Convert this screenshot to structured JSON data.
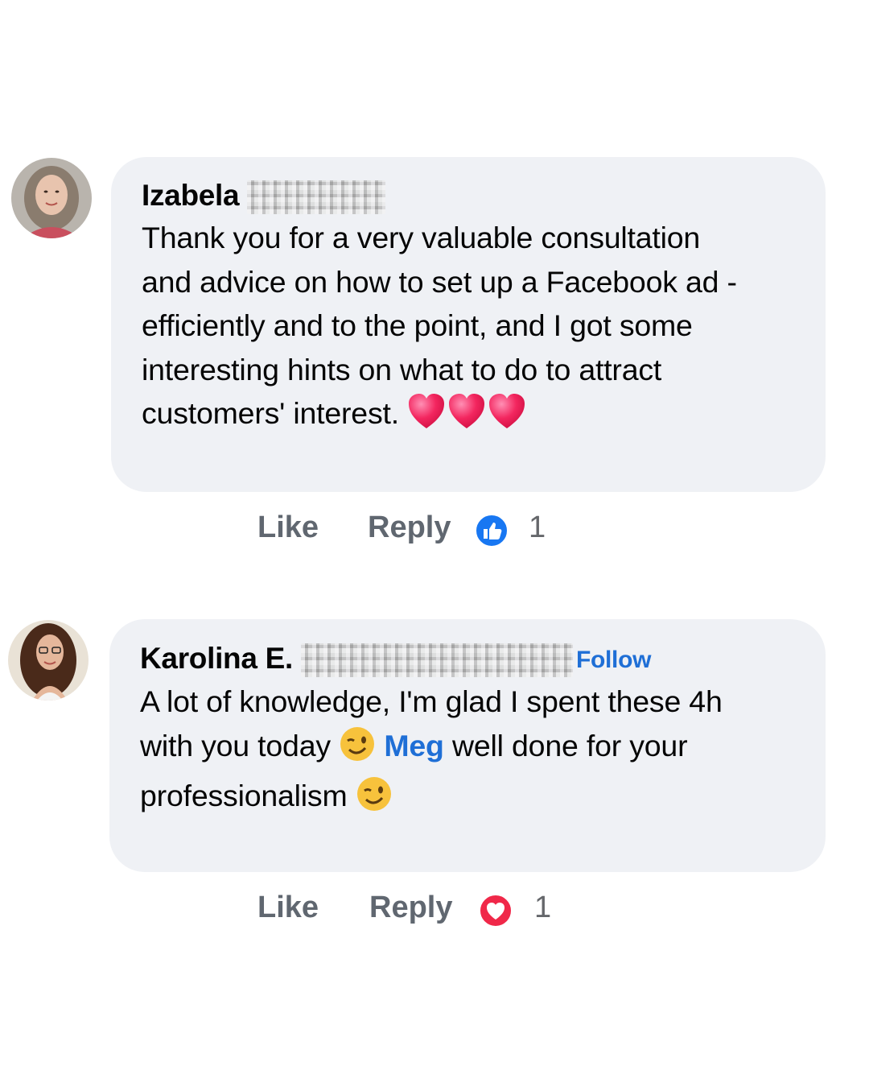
{
  "comments": [
    {
      "author_first": "Izabela",
      "author_hidden": "Olendzki",
      "follow_label": "",
      "lines": [
        "Thank you for a very valuable consultation",
        "and advice on how to set up a Facebook ad -",
        "efficiently and to the point, and I got some",
        "interesting hints on what to do to attract",
        "customers' interest."
      ],
      "like_label": "Like",
      "reply_label": "Reply",
      "reaction_icon": "like-reaction-icon",
      "reaction_count": "1"
    },
    {
      "author_first": "Karolina E.",
      "author_hidden": "Mierzejewska",
      "follow_label": "Follow",
      "line1": "A lot of knowledge, I'm glad I spent these 4h",
      "line2_a": "with you today",
      "mention": "Meg",
      "line2_b": "well done for your",
      "line3": "professionalism",
      "like_label": "Like",
      "reply_label": "Reply",
      "reaction_icon": "love-reaction-icon",
      "reaction_count": "1"
    }
  ],
  "colors": {
    "bubble": "#eff1f5",
    "link": "#1f6fd6",
    "like_blue": "#1877f2",
    "love_red": "#f02849",
    "action_gray": "#606770"
  }
}
